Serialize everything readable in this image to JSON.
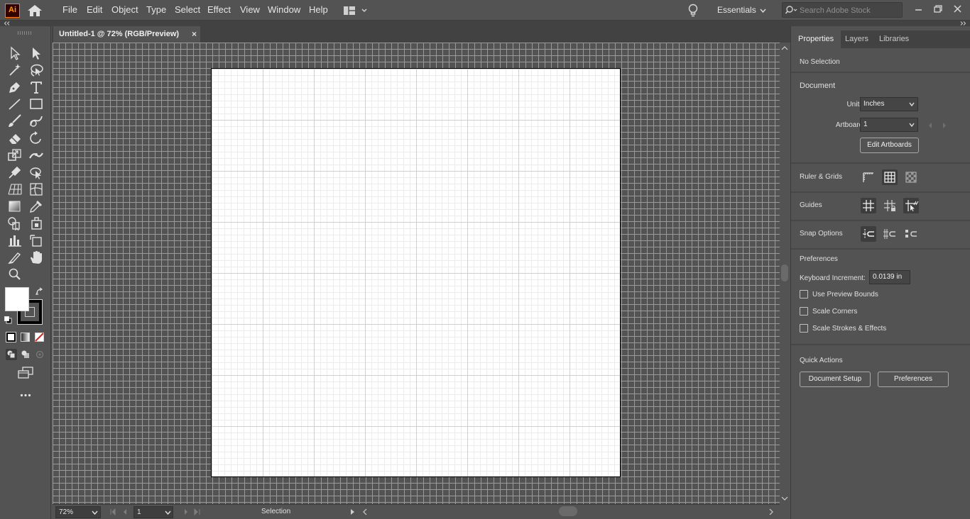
{
  "app": {
    "logo_text": "Ai",
    "brand_color": "#ff9a00"
  },
  "menu": [
    "File",
    "Edit",
    "Object",
    "Type",
    "Select",
    "Effect",
    "View",
    "Window",
    "Help"
  ],
  "workspace": {
    "label": "Essentials"
  },
  "search": {
    "placeholder": "Search Adobe Stock"
  },
  "document_tab": {
    "title": "Untitled-1 @ 72% (RGB/Preview)",
    "close": "×"
  },
  "statusbar": {
    "zoom": "72%",
    "artboard": "1",
    "tool": "Selection"
  },
  "panel": {
    "tabs": [
      "Properties",
      "Layers",
      "Libraries"
    ],
    "selection_status": "No Selection",
    "document": {
      "title": "Document",
      "units_label": "Units:",
      "units_value": "Inches",
      "artboard_label": "Artboard:",
      "artboard_value": "1",
      "edit_artboards": "Edit Artboards"
    },
    "ruler_grids_title": "Ruler & Grids",
    "guides_title": "Guides",
    "snap_title": "Snap Options",
    "preferences": {
      "title": "Preferences",
      "keyboard_increment_label": "Keyboard Increment:",
      "keyboard_increment_value": "0.0139 in",
      "use_preview_bounds": "Use Preview Bounds",
      "scale_corners": "Scale Corners",
      "scale_strokes": "Scale Strokes & Effects"
    },
    "quick_actions": {
      "title": "Quick Actions",
      "document_setup": "Document Setup",
      "preferences": "Preferences"
    }
  },
  "colors": {
    "fill": "#ffffff",
    "stroke": "#000000",
    "none_swatch": "#e02020"
  }
}
